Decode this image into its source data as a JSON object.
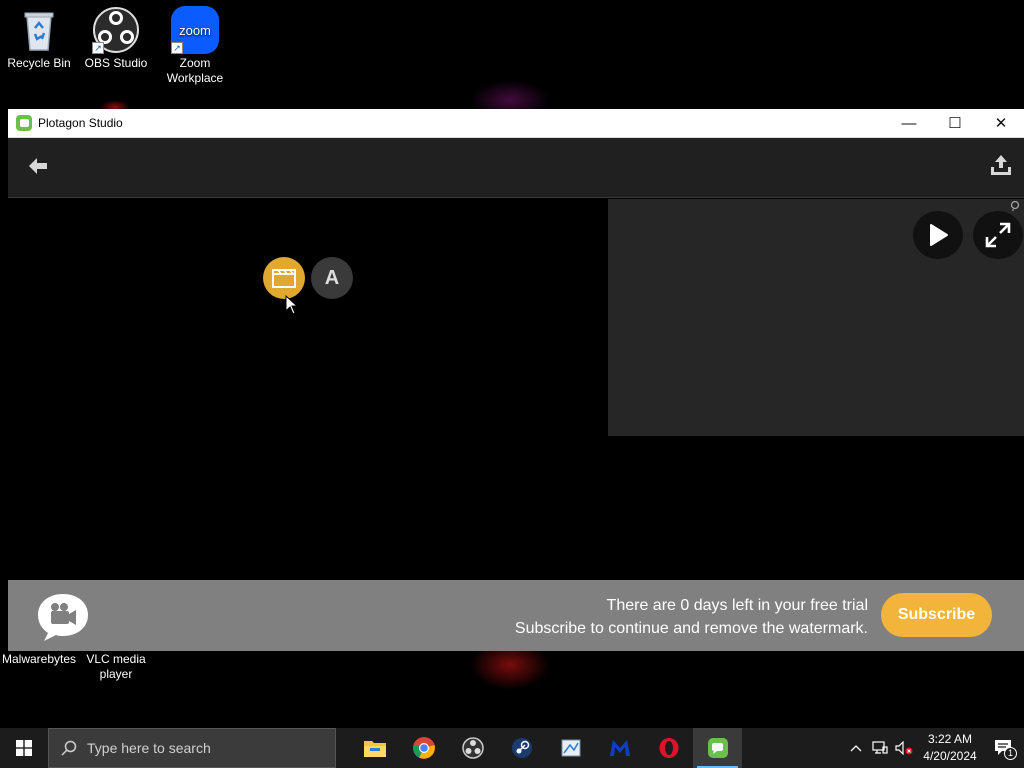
{
  "desktop": {
    "icons": [
      {
        "label": "Recycle Bin"
      },
      {
        "label": "OBS Studio"
      },
      {
        "label": "Zoom Workplace",
        "badge": "zoom"
      },
      {
        "label": "Malwarebytes"
      },
      {
        "label": "VLC media player"
      }
    ]
  },
  "window": {
    "title": "Plotagon Studio",
    "controls": {
      "minimize": "—",
      "maximize": "☐",
      "close": "✕"
    }
  },
  "toolbar": {
    "back_icon": "arrow-left-icon",
    "export_icon": "export-icon"
  },
  "editor": {
    "text_button_label": "A",
    "scene_button_icon": "clapperboard-icon"
  },
  "banner": {
    "line1": "There are 0 days left in your free trial",
    "line2": "Subscribe to continue and remove the watermark.",
    "subscribe_label": "Subscribe"
  },
  "taskbar": {
    "search_placeholder": "Type here to search",
    "apps": [
      "file-explorer",
      "chrome",
      "obs-studio",
      "steam",
      "paint",
      "malwarebytes",
      "opera",
      "plotagon"
    ],
    "time": "3:22 AM",
    "date": "4/20/2024",
    "notification_count": "1"
  },
  "colors": {
    "accent_yellow": "#f2b43a",
    "plotagon_green": "#6cbf4a",
    "banner_gray": "#808080"
  }
}
